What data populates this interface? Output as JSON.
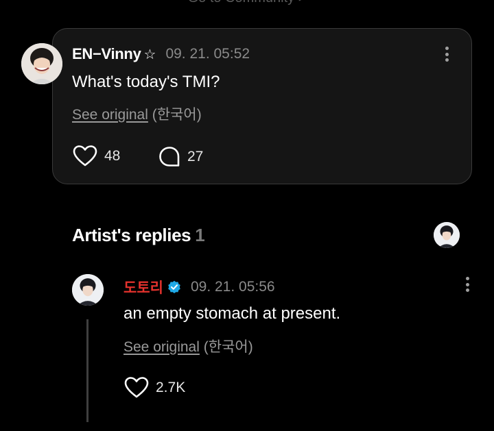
{
  "header": {
    "community_link": "Go to Community >"
  },
  "post": {
    "author": "EN−Vinny",
    "author_badge_icon": "star-outline-icon",
    "timestamp": "09. 21. 05:52",
    "text": "What's today's TMI?",
    "see_original": "See original",
    "language": "(한국어)",
    "likes": "48",
    "comments": "27"
  },
  "replies_section": {
    "title": "Artist's replies",
    "count": "1"
  },
  "reply": {
    "author": "도토리",
    "author_color": "#e5322d",
    "verified_color": "#1fa9e6",
    "timestamp": "09. 21. 05:56",
    "text": "an empty stomach at present.",
    "see_original": "See original",
    "language": "(한국어)",
    "likes": "2.7K"
  },
  "colors": {
    "background": "#000000",
    "card": "#151515",
    "muted": "#8a8a8a"
  }
}
